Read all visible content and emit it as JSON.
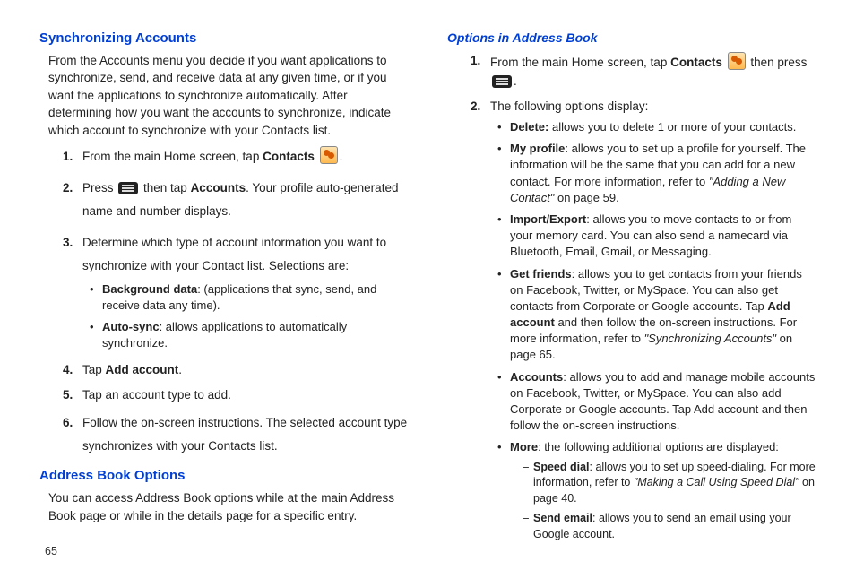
{
  "left": {
    "h_sync": "Synchronizing Accounts",
    "sync_intro": "From the Accounts menu you decide if you want applications to synchronize, send, and receive data at any given time, or if you want the applications to synchronize automatically. After determining how you want the accounts to synchronize, indicate which account to synchronize with your Contacts list.",
    "s1a": "From the main Home screen, tap ",
    "s1b": "Contacts",
    "s1c": ".",
    "s2a": "Press ",
    "s2b": " then tap ",
    "s2c": "Accounts",
    "s2d": ". Your profile auto-generated name and number displays.",
    "s3": "Determine which type of account information you want to synchronize with your Contact list. Selections are:",
    "s3_b1a": "Background data",
    "s3_b1b": ": (applications that sync, send, and receive data any time).",
    "s3_b2a": "Auto-sync",
    "s3_b2b": ": allows applications to automatically synchronize.",
    "s4a": "Tap ",
    "s4b": "Add account",
    "s4c": ".",
    "s5": "Tap an account type to add.",
    "s6": "Follow the on-screen instructions. The selected account type synchronizes with your Contacts list.",
    "h_addr": "Address Book Options",
    "addr_intro": "You can access Address Book options while at the main Address Book page or while in the details page for a specific entry."
  },
  "right": {
    "h_opts": "Options in Address Book",
    "o1a": "From the main Home screen, tap ",
    "o1b": "Contacts",
    "o1c": " then press ",
    "o1d": ".",
    "o2": "The following options display:",
    "b_del_a": "Delete:",
    "b_del_b": " allows you to delete 1 or more of your contacts.",
    "b_prof_a": "My profile",
    "b_prof_b": ": allows you to set up a profile for yourself. The information will be the same that you can add for a new contact. For more information, refer to ",
    "b_prof_c": "\"Adding a New Contact\"",
    "b_prof_d": "  on page 59.",
    "b_imp_a": "Import/Export",
    "b_imp_b": ": allows you to move contacts to or from your memory card. You can also send a namecard via Bluetooth, Email, Gmail, or Messaging.",
    "b_fr_a": "Get friends",
    "b_fr_b": ": allows you to get contacts from your friends on Facebook, Twitter, or MySpace. You can also get contacts from Corporate or Google accounts. Tap ",
    "b_fr_c": "Add account",
    "b_fr_d": " and then follow the on-screen instructions. For more information, refer to ",
    "b_fr_e": "\"Synchronizing Accounts\"",
    "b_fr_f": "  on page 65.",
    "b_acc_a": "Accounts",
    "b_acc_b": ": allows you to add and manage mobile accounts on Facebook, Twitter, or MySpace. You can also add Corporate or Google accounts. Tap Add account and then follow the on-screen instructions.",
    "b_more_a": "More",
    "b_more_b": ": the following additional options are displayed:",
    "d_sd_a": "Speed dial",
    "d_sd_b": ": allows you to set up speed-dialing. For more information, refer to ",
    "d_sd_c": "\"Making a Call Using Speed Dial\"",
    "d_sd_d": "  on page 40.",
    "d_se_a": "Send email",
    "d_se_b": ": allows you to send an email using your Google account."
  },
  "page_number": "65"
}
